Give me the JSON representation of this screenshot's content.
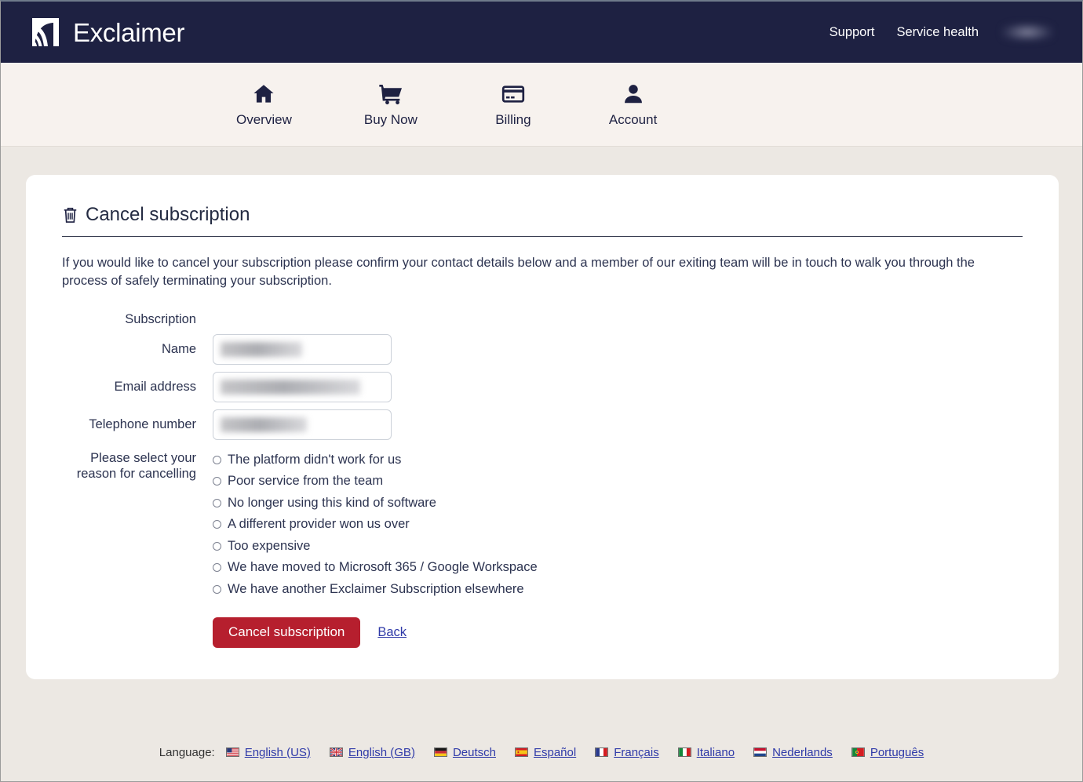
{
  "colors": {
    "header_bg": "#1e2142",
    "nav_bg": "#f7f2ee",
    "page_bg": "#ece8e3",
    "card_bg": "#ffffff",
    "danger_button": "#b61f2e",
    "link": "#2f3aa8",
    "text": "#2c3350"
  },
  "header": {
    "brand_name": "Exclaimer",
    "links": [
      {
        "label": "Support"
      },
      {
        "label": "Service health"
      }
    ],
    "user_redacted": ""
  },
  "nav": {
    "items": [
      {
        "label": "Overview",
        "icon": "home-icon"
      },
      {
        "label": "Buy Now",
        "icon": "shopping-cart-icon"
      },
      {
        "label": "Billing",
        "icon": "credit-card-icon"
      },
      {
        "label": "Account",
        "icon": "person-icon"
      }
    ]
  },
  "card": {
    "title": "Cancel subscription",
    "title_icon": "trash-icon",
    "intro": "If you would like to cancel your subscription please confirm your contact details below and a member of our exiting team will be in touch to walk you through the process of safely terminating your subscription.",
    "section_label": "Subscription",
    "fields": [
      {
        "label": "Name",
        "value": "",
        "placeholder": ""
      },
      {
        "label": "Email address",
        "value": "",
        "placeholder": ""
      },
      {
        "label": "Telephone number",
        "value": "",
        "placeholder": ""
      }
    ],
    "reason_label_line1": "Please select your",
    "reason_label_line2": "reason for cancelling",
    "reasons": [
      {
        "label": "The platform didn't work for us",
        "selected": false
      },
      {
        "label": "Poor service from the team",
        "selected": false
      },
      {
        "label": "No longer using this kind of software",
        "selected": false
      },
      {
        "label": "A different provider won us over",
        "selected": false
      },
      {
        "label": "Too expensive",
        "selected": false
      },
      {
        "label": "We have moved to Microsoft 365 / Google Workspace",
        "selected": false
      },
      {
        "label": "We have another Exclaimer Subscription elsewhere",
        "selected": false
      }
    ],
    "submit_label": "Cancel subscription",
    "back_label": "Back"
  },
  "footer": {
    "language_label": "Language:",
    "languages": [
      {
        "name": "English (US)",
        "flag": "us"
      },
      {
        "name": "English (GB)",
        "flag": "gb"
      },
      {
        "name": "Deutsch",
        "flag": "de"
      },
      {
        "name": "Español",
        "flag": "es"
      },
      {
        "name": "Français",
        "flag": "fr"
      },
      {
        "name": "Italiano",
        "flag": "it"
      },
      {
        "name": "Nederlands",
        "flag": "nl"
      },
      {
        "name": "Português",
        "flag": "pt"
      }
    ]
  }
}
